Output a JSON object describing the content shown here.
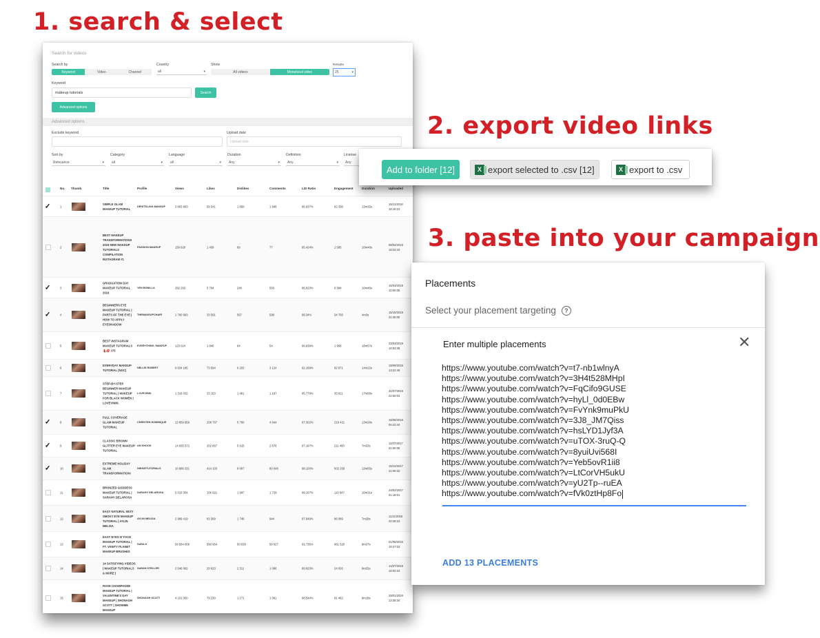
{
  "steps": {
    "s1": "1. search & select",
    "s2": "2. export video links",
    "s3": "3. paste into your campaign"
  },
  "search": {
    "title": "Search for videos",
    "search_by_label": "Search by",
    "search_by_options": [
      "Keyword",
      "Video",
      "Channel"
    ],
    "country_label": "Country",
    "country_value": "all",
    "show_label": "Show",
    "show_options": [
      "All videos",
      "Monetized video"
    ],
    "results_label": "Results",
    "results_value": "25",
    "keyword_label": "Keyword",
    "keyword_value": "makeup tutorials",
    "search_button": "Search",
    "advanced_button": "Advanced options",
    "advanced_header": "Advanced options",
    "exclude_label": "Exclude keyword",
    "upload_label": "Upload date",
    "upload_placeholder": "Upload date",
    "filters": [
      {
        "label": "Sort by",
        "value": "Relevance"
      },
      {
        "label": "Category",
        "value": "all"
      },
      {
        "label": "Language",
        "value": "all"
      },
      {
        "label": "Duration",
        "value": "Any"
      },
      {
        "label": "Definition",
        "value": "Any"
      },
      {
        "label": "License",
        "value": "Any"
      }
    ]
  },
  "table": {
    "columns": [
      "No.",
      "Thumb",
      "Title",
      "Profile",
      "Views",
      "Likes",
      "Dislikes",
      "Comments",
      "L/D Ratio",
      "Engagement",
      "Duration",
      "Uploaded"
    ],
    "rows": [
      {
        "checked": true,
        "no": "1",
        "title": "SIMPLE GLAM MAKEUP TUTORIAL",
        "profile": "DENITSLAVA MAKEUP",
        "views": "3 803 803",
        "likes": "58 541",
        "dislikes": "1 850",
        "comments": "1 945",
        "ratio": "96.937%",
        "engagement": "62 336",
        "duration": "13m35s",
        "uploaded": "15/11/2018 18:10:24"
      },
      {
        "checked": false,
        "no": "2",
        "title": "BEST MAKEUP TRANSFORMATIONS 2019 NEW MAKEUP TUTORIALS COMPILATION INSTAGRAM #1",
        "profile": "PASSION MAKEUP",
        "views": "150 620",
        "likes": "1 439",
        "dislikes": "69",
        "comments": "77",
        "ratio": "95.424%",
        "engagement": "1 585",
        "duration": "10m46s",
        "uploaded": "08/04/2019 18:22:43"
      },
      {
        "checked": true,
        "no": "3",
        "title": "GRADUATION DAY MAKEUP TUTORIAL 2019",
        "profile": "YEN BONILLA",
        "views": "262 263",
        "likes": "5 794",
        "dislikes": "240",
        "comments": "550",
        "ratio": "96.023%",
        "engagement": "6 584",
        "duration": "10m46s",
        "uploaded": "16/03/2019 10:00:06"
      },
      {
        "checked": true,
        "no": "4",
        "title": "BEGINNERS EYE MAKEUP TUTORIAL | PARTS OF THE EYE | HOW TO APPLY EYESHADOW",
        "profile": "THEMAKEUPCHAIR",
        "views": "1 760 993",
        "likes": "33 591",
        "dislikes": "567",
        "comments": "598",
        "ratio": "98.34%",
        "engagement": "34 756",
        "duration": "4m3s",
        "uploaded": "15/10/2018 21:30:00"
      },
      {
        "checked": false,
        "no": "5",
        "title": "BEST INSTAGRAM MAKEUP TUTORIALS 💄💋 #75",
        "profile": "EVERYTHING_MAKEUP",
        "views": "123 024",
        "likes": "1 840",
        "dislikes": "64",
        "comments": "54",
        "ratio": "96.639%",
        "engagement": "1 958",
        "duration": "18m57s",
        "uploaded": "23/03/2019 18:53:38"
      },
      {
        "checked": false,
        "no": "6",
        "title": "EVERYDAY MAKEUP TUTORIAL (NOC)",
        "profile": "NELLIE ROBERT",
        "views": "6 634 185",
        "likes": "73 594",
        "dislikes": "6 253",
        "comments": "3 124",
        "ratio": "92.169%",
        "engagement": "82 971",
        "duration": "14m22s",
        "uploaded": "19/09/2016 13:22:49"
      },
      {
        "checked": false,
        "no": "7",
        "title": "STEP-BY-STEP BEGINNER MAKEUP TUTORIAL | MAKEUP FOR BLACK WOMEN | LOVEVINNI_",
        "profile": "LOVEVINNI_",
        "views": "1 316 032",
        "likes": "33 153",
        "dislikes": "1 461",
        "comments": "1 197",
        "ratio": "95.779%",
        "engagement": "35 811",
        "duration": "17m58s",
        "uploaded": "31/07/2018 22:50:03"
      },
      {
        "checked": true,
        "no": "8",
        "title": "FULL COVERAGE GLAM MAKEUP TUTORIAL",
        "profile": "CHRISTEN DOMINIQUE",
        "views": "13 859 859",
        "likes": "208 767",
        "dislikes": "5 790",
        "comments": "4 844",
        "ratio": "97.302%",
        "engagement": "219 421",
        "duration": "13m28s",
        "uploaded": "16/08/2016 04:42:44"
      },
      {
        "checked": true,
        "no": "9",
        "title": "CLASSIC BROWN GLITTER EYE MAKEUP TUTORIAL",
        "profile": "AN KNOOK",
        "views": "14 935 572",
        "likes": "202 867",
        "dislikes": "5 915",
        "comments": "2 678",
        "ratio": "97.167%",
        "engagement": "211 460",
        "duration": "7m32s",
        "uploaded": "11/07/2017 21:00:06"
      },
      {
        "checked": true,
        "no": "10",
        "title": "EXTREME HOLIDAY GLAM TRANSFORMATION!",
        "profile": "NIKKIETUTORIALS",
        "views": "10 886 331",
        "likes": "414 103",
        "dislikes": "8 007",
        "comments": "80 048",
        "ratio": "98.103%",
        "engagement": "502 158",
        "duration": "12m55s",
        "uploaded": "16/12/2017 21:00:32"
      },
      {
        "checked": false,
        "no": "11",
        "title": "BRONZED GODDESS MAKEUP TUTORIAL | SARAHY DELAROSA",
        "profile": "SARAHY DELAROSA",
        "views": "5 019 354",
        "likes": "106 921",
        "dislikes": "1 997",
        "comments": "1 729",
        "ratio": "98.167%",
        "engagement": "110 647",
        "duration": "10m31s",
        "uploaded": "24/02/2017 01:19:01"
      },
      {
        "checked": false,
        "no": "12",
        "title": "EASY NATURAL SEXY SMOKY EYE MAKEUP TUTORIAL | AYLIN MELISA",
        "profile": "AYLIN MELISA",
        "views": "2 989 419",
        "likes": "83 399",
        "dislikes": "1 746",
        "comments": "944",
        "ratio": "97.949%",
        "engagement": "86 089",
        "duration": "7m29s",
        "uploaded": "11/11/2018 22:29:23"
      },
      {
        "checked": false,
        "no": "13",
        "title": "EASY EYES N' FACE MAKEUP TUTORIAL | FT. VANITY PLANET MAKEUP BRUSHES",
        "profile": "SARA K",
        "views": "58 584 009",
        "likes": "560 954",
        "dislikes": "50 539",
        "comments": "50 027",
        "ratio": "91.735%",
        "engagement": "661 520",
        "duration": "9m37s",
        "uploaded": "01/09/2016 19:27:03"
      },
      {
        "checked": false,
        "no": "14",
        "title": "14 SATISFYING VIDEOS ( MAKEUP TUTORIALS & MORE )",
        "profile": "SARAH STELLER",
        "views": "2 546 062",
        "likes": "20 623",
        "dislikes": "2 311",
        "comments": "1 086",
        "ratio": "89.923%",
        "engagement": "24 020",
        "duration": "9m32s",
        "uploaded": "14/07/2018 18:02:24"
      },
      {
        "checked": false,
        "no": "15",
        "title": "ROSE CHAMPAGNE MAKEUP TUTORIAL | VALENTINE'S DAY MAKEUP | SHONAGH SCOTT | SHOWME MAKEUP",
        "profile": "SHONAGH SCOTT",
        "views": "4 101 350",
        "likes": "79 230",
        "dislikes": "1 171",
        "comments": "1 061",
        "ratio": "98.544%",
        "engagement": "81 462",
        "duration": "9m18s",
        "uploaded": "28/01/2016 13:35:34"
      }
    ]
  },
  "export": {
    "folder_label": "Add to folder [12]",
    "selected_label": "export selected to .csv [12]",
    "all_label": "export to .csv",
    "icon": "excel-icon"
  },
  "placements": {
    "title": "Placements",
    "subtitle": "Select your placement targeting",
    "box_title": "Enter multiple placements",
    "urls": [
      "https://www.youtube.com/watch?v=t7-nb1wlnyA",
      "https://www.youtube.com/watch?v=3H4t528MHpI",
      "https://www.youtube.com/watch?v=FqCifo9GUSE",
      "https://www.youtube.com/watch?v=hyLl_0d0EBw",
      "https://www.youtube.com/watch?v=FvYnk9muPkU",
      "https://www.youtube.com/watch?v=3J8_JM7Qiss",
      "https://www.youtube.com/watch?v=hsLYD1Jyf3A",
      "https://www.youtube.com/watch?v=uTOX-3ruQ-Q",
      "https://www.youtube.com/watch?v=8yuiUvi568I",
      "https://www.youtube.com/watch?v=Yeb5ovR1ii8",
      "https://www.youtube.com/watch?v=LtCorVH5ukU",
      "https://www.youtube.com/watch?v=yU2Tp--ruEA",
      "https://www.youtube.com/watch?v=fVk0ztHp8Fo"
    ],
    "add_button": "ADD 13 PLACEMENTS"
  }
}
